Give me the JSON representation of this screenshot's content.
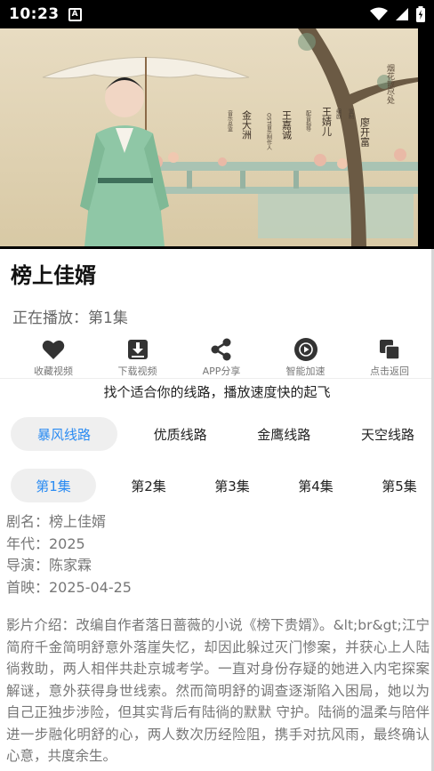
{
  "status_bar": {
    "time": "10:23",
    "notification_icon": "A"
  },
  "video": {
    "poster_credits": [
      "廖开富",
      "王婧儿",
      "王嘉诚",
      "金大洲"
    ],
    "poster_roles": [
      "监制",
      "编剧",
      "配音指导",
      "OST音乐制作人",
      "音乐总监"
    ],
    "poster_tagline": "烟花散尽处"
  },
  "title": "榜上佳婿",
  "now_playing": "正在播放：第1集",
  "actions": [
    {
      "icon": "heart-icon",
      "label": "收藏视频"
    },
    {
      "icon": "download-icon",
      "label": "下载视频"
    },
    {
      "icon": "share-icon",
      "label": "APP分享"
    },
    {
      "icon": "play-circle-icon",
      "label": "智能加速"
    },
    {
      "icon": "copy-back-icon",
      "label": "点击返回"
    }
  ],
  "hint": "找个适合你的线路，播放速度快的起飞",
  "lines": [
    "暴风线路",
    "优质线路",
    "金鹰线路",
    "天空线路"
  ],
  "episodes": [
    "第1集",
    "第2集",
    "第3集",
    "第4集",
    "第5集"
  ],
  "info": {
    "name": "剧名：榜上佳婿",
    "year": "年代：2025",
    "director": "导演：陈家霖",
    "premiere": "首映：2025-04-25"
  },
  "description": "影片介绍：改编自作者落日蔷薇的小说《榜下贵婿》。&lt;br&gt;江宁简府千金简明舒意外落崖失忆，却因此躲过灭门惨案，并获心上人陆徜救助，两人相伴共赴京城考学。一直对身份存疑的她进入内宅探案解谜，意外获得身世线索。然而简明舒的调查逐渐陷入困局，她以为自己正独步涉险，但其实背后有陆徜的默默 守护。陆徜的温柔与陪伴进一步融化明舒的心，两人数次历经险阻，携手对抗风雨，最终确认心意，共度余生。",
  "colors": {
    "accent": "#2a8bf2",
    "pill_bg": "#efefef",
    "muted_text": "#777777"
  }
}
